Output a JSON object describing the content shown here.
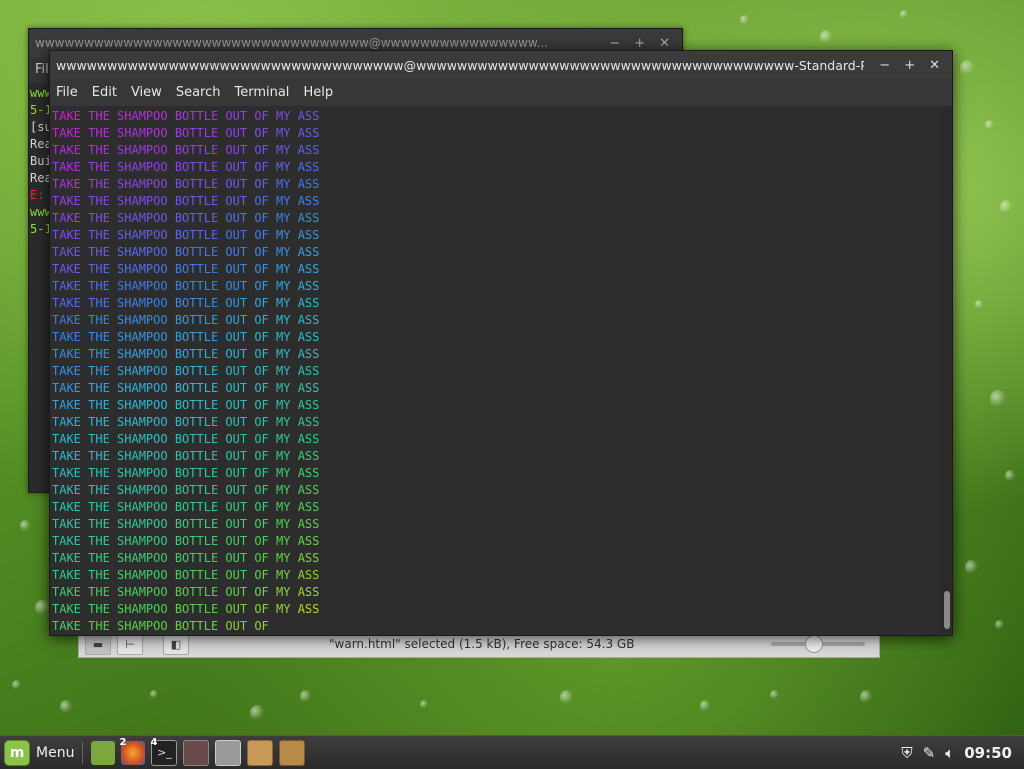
{
  "back_window": {
    "title": "wwwwwwwwwwwwwwwwwwwwwwwwwwwwwwwwww@wwwwwwwwwwwwwwww...",
    "menu_fragment": "Fil",
    "line_fragments": [
      {
        "text": "www",
        "color": "#8ae234"
      },
      {
        "text": "5-1",
        "color": "#8ae234"
      },
      {
        "text": "[su",
        "color": "#d3d7cf"
      },
      {
        "text": "Rea",
        "color": "#d3d7cf"
      },
      {
        "text": "Bui",
        "color": "#d3d7cf"
      },
      {
        "text": "Rea",
        "color": "#d3d7cf"
      },
      {
        "text": "E:",
        "color": "#ef2929"
      },
      {
        "text": "www",
        "color": "#8ae234"
      },
      {
        "text": "5-1",
        "color": "#8ae234"
      }
    ]
  },
  "window_controls": {
    "minimize": "−",
    "maximize": "+",
    "close": "✕"
  },
  "front_window": {
    "title": "wwwwwwwwwwwwwwwwwwwwwwwwwwwwwwwwww@wwwwwwwwwwwwwwwwwwwwwwwwwwwwwwwwwwwww-Standard-PC...",
    "menu": [
      "File",
      "Edit",
      "View",
      "Search",
      "Terminal",
      "Help"
    ],
    "words": [
      "TAKE",
      "THE",
      "SHAMPOO",
      "BOTTLE",
      "OUT",
      "OF",
      "MY",
      "ASS"
    ],
    "full_line_count": 30,
    "last_line_word_count": 6,
    "colors": {
      "magenta": "#d020d0",
      "purple": "#8844e8",
      "blue": "#3d7de8",
      "cyan": "#2fb6d8",
      "teal": "#2ec89a",
      "green": "#4fd248",
      "yellow": "#c8d22a"
    }
  },
  "file_manager": {
    "status_text": "\"warn.html\" selected (1.5 kB), Free space: 54.3 GB",
    "zoom_fraction": 0.45
  },
  "taskbar": {
    "menu_label": "Menu",
    "clock": "09:50",
    "badges": {
      "firefox": "2",
      "terminal": "4"
    }
  }
}
